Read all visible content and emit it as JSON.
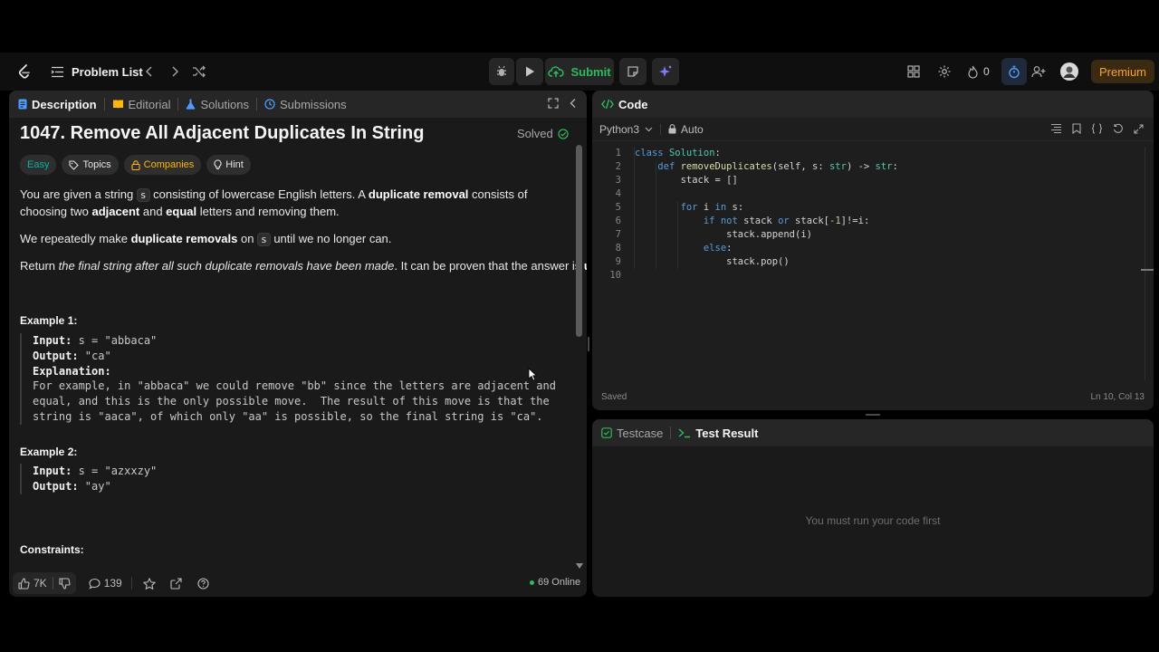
{
  "topbar": {
    "problem_list": "Problem List",
    "submit": "Submit",
    "streak_count": "0",
    "premium": "Premium"
  },
  "left": {
    "tabs": [
      "Description",
      "Editorial",
      "Solutions",
      "Submissions"
    ],
    "title": "1047. Remove All Adjacent Duplicates In String",
    "solved": "Solved",
    "chips": {
      "difficulty": "Easy",
      "topics": "Topics",
      "companies": "Companies",
      "hint": "Hint"
    },
    "p1": {
      "a": "You are given a string ",
      "code_s": "s",
      "b": " consisting of lowercase English letters. A ",
      "c": "duplicate removal",
      "d": " consists of choosing two ",
      "e": "adjacent",
      "f": " and ",
      "g": "equal",
      "h": " letters and removing them."
    },
    "p2": {
      "a": "We repeatedly make ",
      "b": "duplicate removals",
      "c": " on ",
      "code_s": "s",
      "d": " until we no longer can."
    },
    "p3": {
      "a": "Return ",
      "b": "the final string after all such duplicate removals have been made",
      "c": ". It can be proven that the answer is ",
      "d": "unique",
      "e": "."
    },
    "example1": {
      "heading": "Example 1:",
      "input_label": "Input:",
      "input_value": " s = \"abbaca\"",
      "output_label": "Output:",
      "output_value": " \"ca\"",
      "explanation_label": "Explanation:",
      "explanation_lines": [
        "For example, in \"abbaca\" we could remove \"bb\" since the letters are adjacent and",
        "equal, and this is the only possible move.  The result of this move is that the",
        "string is \"aaca\", of which only \"aa\" is possible, so the final string is \"ca\"."
      ]
    },
    "example2": {
      "heading": "Example 2:",
      "input_label": "Input:",
      "input_value": " s = \"azxxzy\"",
      "output_label": "Output:",
      "output_value": " \"ay\""
    },
    "constraints_heading": "Constraints:",
    "footer": {
      "likes": "7K",
      "comments": "139",
      "online": "69 Online"
    }
  },
  "code_panel": {
    "title": "Code",
    "language": "Python3",
    "auto": "Auto",
    "status": "Saved",
    "cursor": "Ln 10, Col 13",
    "line_numbers": [
      "1",
      "2",
      "3",
      "4",
      "5",
      "6",
      "7",
      "8",
      "9",
      "10"
    ],
    "lines": [
      [
        [
          "kw",
          "class"
        ],
        [
          "pl",
          " "
        ],
        [
          "cls",
          "Solution"
        ],
        [
          "pl",
          ":"
        ]
      ],
      [
        [
          "pl",
          "    "
        ],
        [
          "kw",
          "def"
        ],
        [
          "pl",
          " "
        ],
        [
          "fn",
          "removeDuplicates"
        ],
        [
          "pl",
          "(self, s: "
        ],
        [
          "cls",
          "str"
        ],
        [
          "pl",
          ") -> "
        ],
        [
          "cls",
          "str"
        ],
        [
          "pl",
          ":"
        ]
      ],
      [
        [
          "pl",
          "        stack = []"
        ]
      ],
      [
        [
          "pl",
          ""
        ]
      ],
      [
        [
          "pl",
          "        "
        ],
        [
          "kw",
          "for"
        ],
        [
          "pl",
          " i "
        ],
        [
          "kw",
          "in"
        ],
        [
          "pl",
          " s:"
        ]
      ],
      [
        [
          "pl",
          "            "
        ],
        [
          "kw",
          "if"
        ],
        [
          "pl",
          " "
        ],
        [
          "kw",
          "not"
        ],
        [
          "pl",
          " stack "
        ],
        [
          "kw",
          "or"
        ],
        [
          "pl",
          " stack["
        ],
        [
          "num",
          "-1"
        ],
        [
          "pl",
          "]!=i:"
        ]
      ],
      [
        [
          "pl",
          "                stack.append(i)"
        ]
      ],
      [
        [
          "pl",
          "            "
        ],
        [
          "kw",
          "else"
        ],
        [
          "pl",
          ":"
        ]
      ],
      [
        [
          "pl",
          "                stack.pop()"
        ]
      ],
      [
        [
          "pl",
          ""
        ]
      ]
    ]
  },
  "test_panel": {
    "testcase_tab": "Testcase",
    "result_tab": "Test Result",
    "empty_message": "You must run your code first"
  },
  "colors": {
    "accent_green": "#2cbb5d",
    "premium": "#ffa116",
    "code_bg": "#1e1e1e"
  }
}
